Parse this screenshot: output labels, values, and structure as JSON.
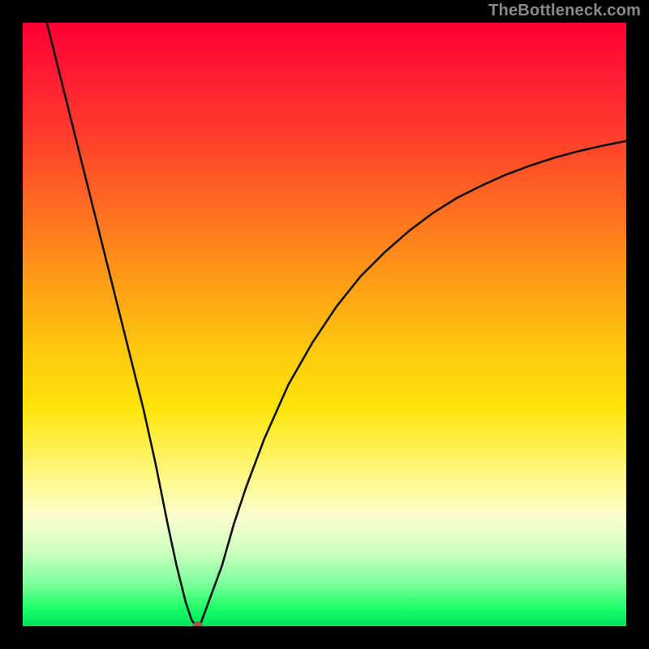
{
  "watermark": "TheBottleneck.com",
  "chart_data": {
    "type": "line",
    "title": "",
    "xlabel": "",
    "ylabel": "",
    "xlim": [
      0,
      100
    ],
    "ylim": [
      0,
      100
    ],
    "x": [
      4,
      6,
      8,
      10,
      12,
      14,
      16,
      18,
      20,
      22,
      24,
      25.5,
      27,
      28,
      28.8,
      29.5,
      33,
      35,
      37,
      40,
      44,
      48,
      52,
      56,
      60,
      64,
      68,
      72,
      76,
      80,
      84,
      88,
      92,
      96,
      100
    ],
    "values": [
      100,
      92,
      84,
      76,
      68,
      60,
      52,
      44,
      36,
      27,
      17,
      10,
      4,
      1,
      0,
      0.5,
      10,
      17,
      23,
      31,
      40,
      47,
      53,
      58,
      62,
      65.5,
      68.5,
      71,
      73,
      74.8,
      76.3,
      77.6,
      78.7,
      79.6,
      80.4
    ],
    "marker": {
      "x": 29,
      "y": 0
    },
    "grid": false,
    "legend": false
  }
}
